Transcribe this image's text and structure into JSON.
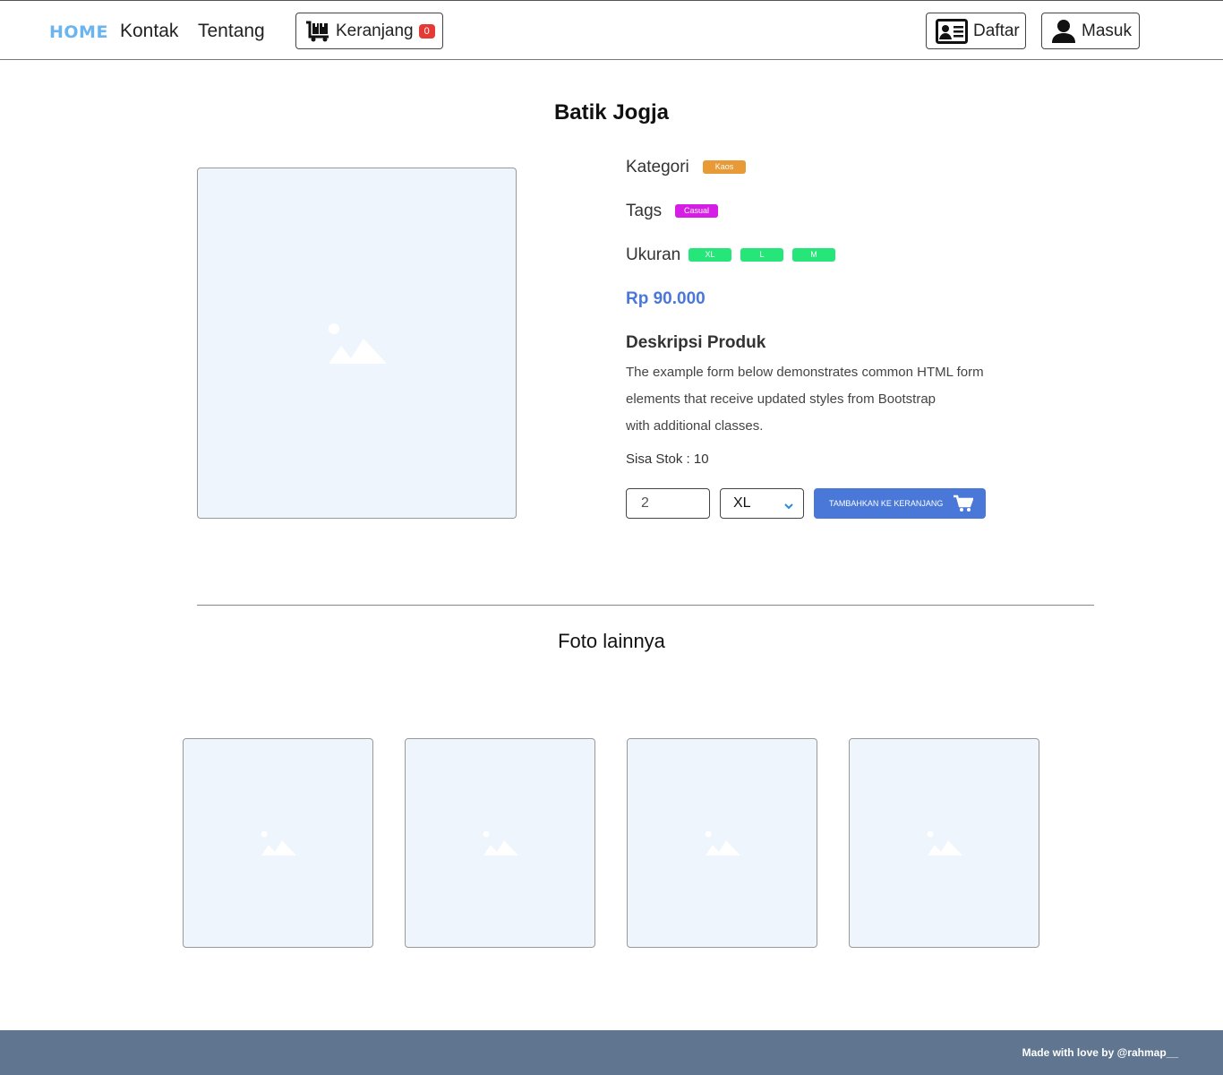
{
  "nav": {
    "home": "HOME",
    "kontak": "Kontak",
    "tentang": "Tentang",
    "cart_label": "Keranjang",
    "cart_count": "0",
    "daftar": "Daftar",
    "masuk": "Masuk"
  },
  "product": {
    "title": "Batik Jogja",
    "kategori_label": "Kategori",
    "kategori": "Kaos",
    "tags_label": "Tags",
    "tags": [
      "Casual"
    ],
    "ukuran_label": "Ukuran",
    "sizes": [
      "XL",
      "L",
      "M"
    ],
    "price": "Rp 90.000",
    "desc_title": "Deskripsi Produk",
    "desc_lines": [
      "The example form below demonstrates common HTML form",
      "elements that receive updated styles from Bootstrap",
      "with additional classes."
    ],
    "stock": "Sisa Stok : 10",
    "qty_value": "2",
    "selected_size": "XL",
    "add_button": "TAMBAHKAN KE KERANJANG"
  },
  "gallery": {
    "title": "Foto lainnya",
    "count": 4
  },
  "footer": {
    "text": "Made with love by @rahmap__"
  },
  "colors": {
    "accent": "#4a78d8",
    "home_link": "#6ab4f0",
    "kategori_badge": "#e79a35",
    "tag_badge": "#d51de6",
    "size_badge": "#26e67a",
    "cart_badge": "#e53935",
    "footer_bg": "#60758f",
    "image_placeholder": "#eef5fd"
  }
}
